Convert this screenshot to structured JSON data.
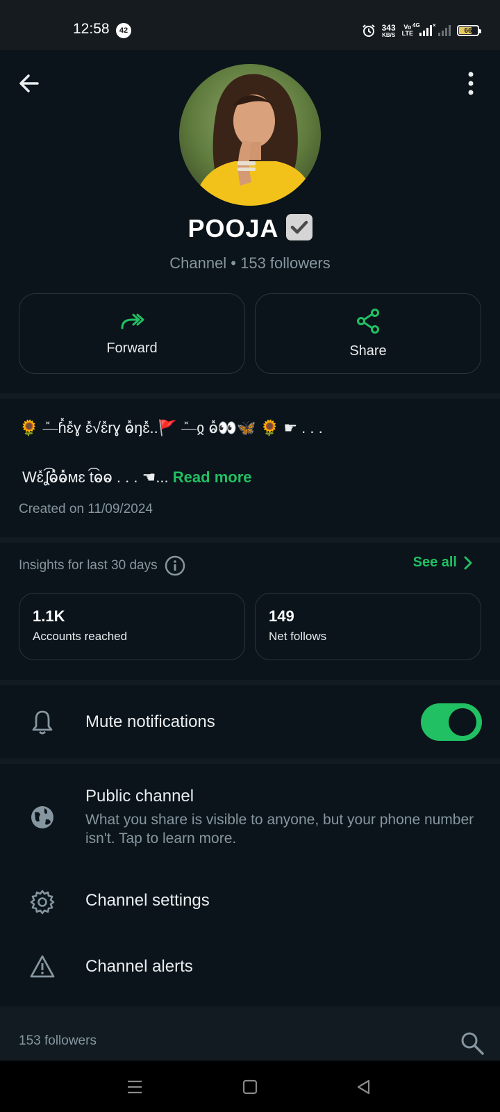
{
  "status_bar": {
    "time": "12:58",
    "notification_count": "42",
    "net_speed_value": "343",
    "net_speed_unit": "KB/S",
    "volte_line1": "Vo",
    "volte_line2": "LTE",
    "network_type": "4G",
    "sim2_label": "×",
    "battery_level": "66"
  },
  "header": {
    "back_icon": "arrow-left-icon",
    "menu_icon": "more-vertical-icon"
  },
  "profile": {
    "name": "POOJA",
    "meta": "Channel • 153 followers",
    "verified_icon": "verified-check-icon"
  },
  "actions": [
    {
      "label": "Forward",
      "icon": "forward-double-arrow-icon"
    },
    {
      "label": "Share",
      "icon": "share-icon"
    }
  ],
  "description": {
    "line1": "🌻 ⎯̽⎯ɦ̽ɛ̽ɣ ɛ̽√ɛ̽rɣ ⱺ̽ŋɛ̽..🚩 ⎯̽⎯ჲ ⱺ̽👀🦋 🌻 ☛ . . .",
    "line2": "Wɛ̽ʆ͡ⱺ̽ⱺ̽ᴍɛ t͡ⱺⱺ . . . ☚...",
    "read_more": "Read more",
    "created": "Created on 11/09/2024"
  },
  "insights": {
    "title": "Insights for last 30 days",
    "see_all": "See all",
    "cards": [
      {
        "value": "1.1K",
        "caption": "Accounts reached"
      },
      {
        "value": "149",
        "caption": "Net follows"
      }
    ]
  },
  "settings": {
    "mute_label": "Mute notifications",
    "mute_enabled": true,
    "public_title": "Public channel",
    "public_sub": "What you share is visible to anyone, but your phone number isn't. Tap to learn more.",
    "channel_settings": "Channel settings",
    "channel_alerts": "Channel alerts"
  },
  "followers_section": {
    "label": "153 followers"
  },
  "colors": {
    "accent": "#21c063",
    "background": "#0b141a",
    "secondary_text": "#8696a0"
  }
}
